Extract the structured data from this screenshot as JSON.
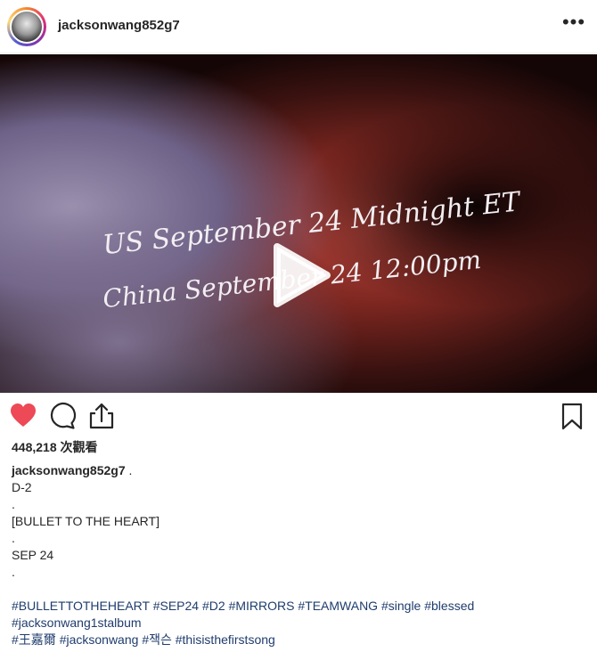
{
  "header": {
    "username": "jacksonwang852g7",
    "more_label": "•••",
    "avatar_icon": "avatar-icon"
  },
  "video": {
    "overlay_lines": [
      "US September 24 Midnight ET",
      "China September 24 12:00pm"
    ],
    "play_icon": "play-icon"
  },
  "actions": {
    "like_icon": "heart-icon",
    "comment_icon": "comment-icon",
    "share_icon": "share-icon",
    "save_icon": "bookmark-icon",
    "liked": true,
    "like_color": "#ed4956"
  },
  "views": "448,218 次觀看",
  "caption": {
    "username": "jacksonwang852g7",
    "username_suffix": " .",
    "lines": [
      "D-2",
      ".",
      "[BULLET TO THE HEART]",
      ".",
      "SEP 24",
      "."
    ]
  },
  "hashtags": {
    "line1": [
      "#BULLETTOTHEHEART",
      "#SEP24",
      "#D2",
      "#MIRRORS",
      "#TEAMWANG",
      "#single",
      "#blessed"
    ],
    "line2": [
      "#jacksonwang1stalbum"
    ],
    "line3": [
      "#王嘉爾",
      "#jacksonwang",
      "#잭슨",
      "#thisisthefirstsong"
    ],
    "color": "#1f3c6d"
  }
}
